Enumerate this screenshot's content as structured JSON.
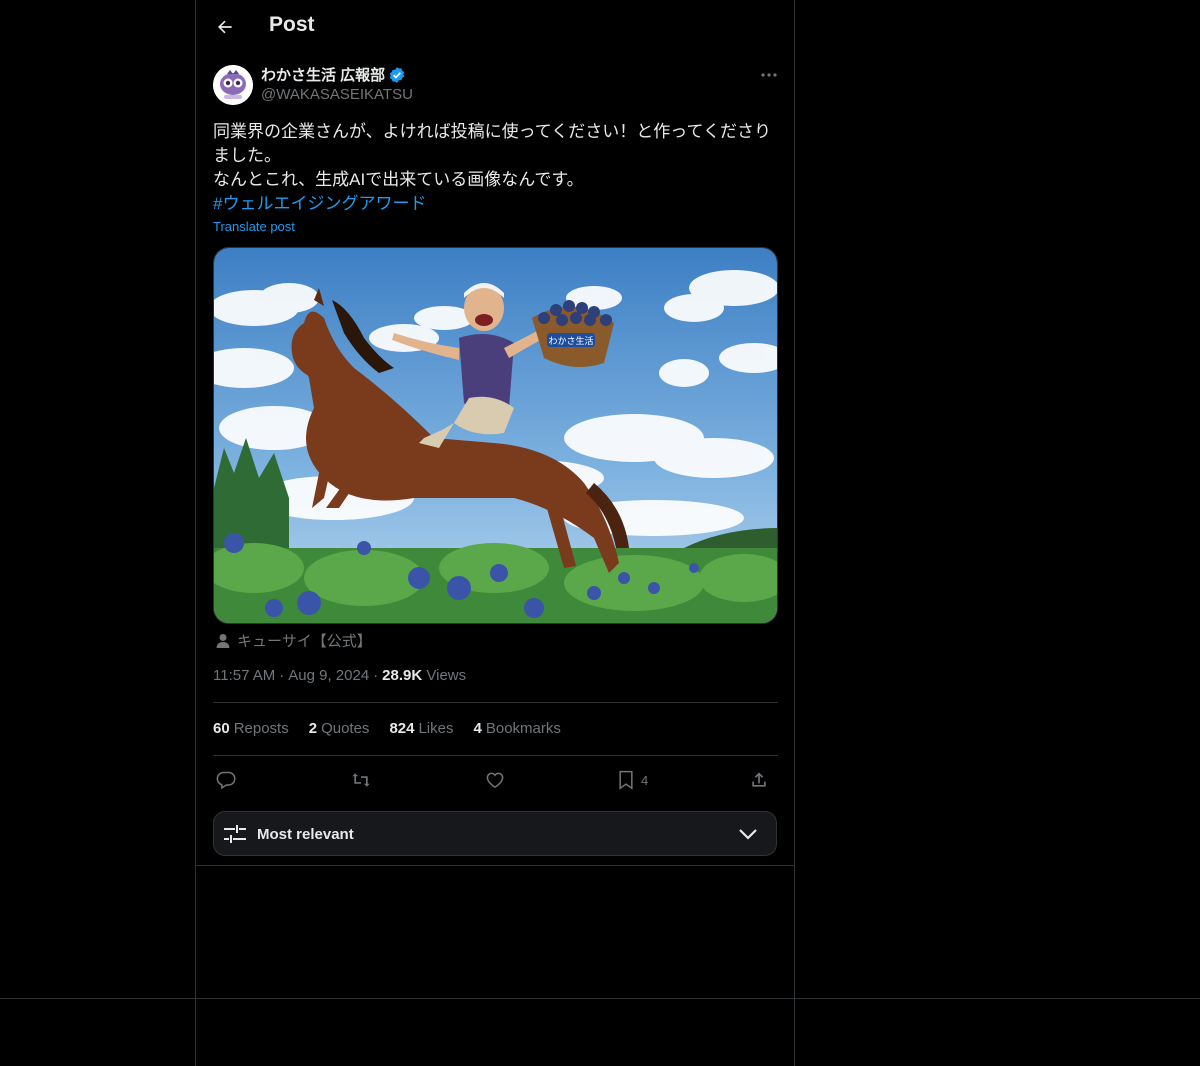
{
  "header": {
    "title": "Post"
  },
  "post": {
    "author_name": "わかさ生活 広報部",
    "author_handle": "@WAKASASEIKATSU",
    "text_line1": "同業界の企業さんが、よければ投稿に使ってください！と作ってくださり",
    "text_line2": "ました。",
    "text_line3": "なんとこれ、生成AIで出来ている画像なんです。",
    "hashtag": "#ウェルエイジングアワード",
    "translate_label": "Translate post",
    "image_credit": "キューサイ【公式】",
    "basket_label": "わかさ生活",
    "time": "11:57 AM",
    "date": "Aug 9, 2024",
    "views_count": "28.9K",
    "views_label": "Views"
  },
  "stats": {
    "reposts_count": "60",
    "reposts_label": "Reposts",
    "quotes_count": "2",
    "quotes_label": "Quotes",
    "likes_count": "824",
    "likes_label": "Likes",
    "bookmarks_count": "4",
    "bookmarks_label": "Bookmarks"
  },
  "actions": {
    "bookmark_count": "4"
  },
  "sort": {
    "label": "Most relevant"
  },
  "colors": {
    "accent": "#1d9bf0",
    "background": "#000000",
    "border": "#2f3336",
    "muted": "#71767b"
  }
}
